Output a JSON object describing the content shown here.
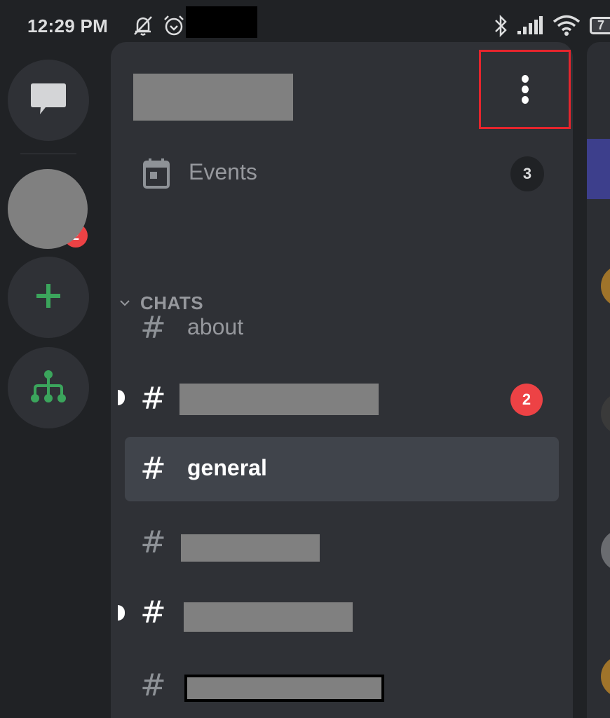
{
  "status_bar": {
    "time": "12:29 PM",
    "icons": [
      "bell-off-icon",
      "alarm-icon",
      "bluetooth-icon",
      "signal-icon",
      "wifi-icon",
      "battery-icon"
    ],
    "battery_level": "7"
  },
  "server_rail": {
    "items": [
      {
        "icon": "direct-messages-icon"
      },
      {
        "icon": "server-avatar",
        "badge": "2"
      },
      {
        "icon": "add-server-icon"
      },
      {
        "icon": "explore-servers-icon"
      }
    ]
  },
  "channel_panel": {
    "server_name": "[redacted]",
    "menu_icon": "more-vertical-icon",
    "events": {
      "label": "Events",
      "count": "3"
    },
    "category": {
      "label": "CHATS",
      "chevron": "chevron-down-icon"
    },
    "channels": [
      {
        "name": "about",
        "state": "read",
        "hash": "#"
      },
      {
        "name": "[redacted]",
        "state": "unread",
        "hash": "#",
        "mentions": "2"
      },
      {
        "name": "general",
        "state": "selected",
        "hash": "#"
      },
      {
        "name": "[redacted]",
        "state": "read",
        "hash": "#"
      },
      {
        "name": "[redacted]",
        "state": "unread",
        "hash": "#"
      },
      {
        "name": "[redacted]",
        "state": "read",
        "hash": "#"
      }
    ]
  },
  "colors": {
    "background": "#202225",
    "panel": "#2f3136",
    "selected": "#40444b",
    "accent_green": "#3ba55c",
    "mention_red": "#ed4245",
    "highlight_box": "#e5252d"
  }
}
